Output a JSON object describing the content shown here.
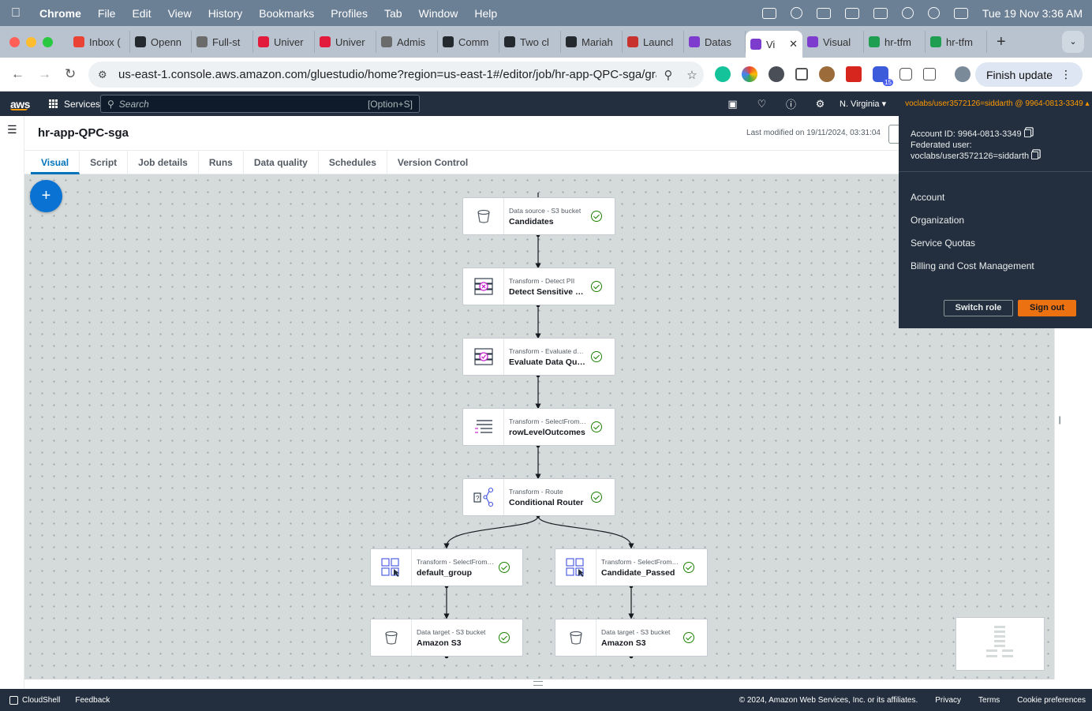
{
  "mac": {
    "app": "Chrome",
    "menu": [
      "File",
      "Edit",
      "View",
      "History",
      "Bookmarks",
      "Profiles",
      "Tab",
      "Window",
      "Help"
    ],
    "clock": "Tue 19 Nov  3:36 AM"
  },
  "tabs": [
    {
      "label": "Inbox (",
      "color": "#ea4335"
    },
    {
      "label": "Openn",
      "color": "#24292f"
    },
    {
      "label": "Full-st",
      "color": "#6b6b6b"
    },
    {
      "label": "Univer",
      "color": "#e21b3c"
    },
    {
      "label": "Univer",
      "color": "#e21b3c"
    },
    {
      "label": "Admis",
      "color": "#6b6b6b"
    },
    {
      "label": "Comm",
      "color": "#24292f"
    },
    {
      "label": "Two cl",
      "color": "#24292f"
    },
    {
      "label": "Mariah",
      "color": "#24292f"
    },
    {
      "label": "Launcl",
      "color": "#c7322f"
    },
    {
      "label": "Datas",
      "color": "#7e3ccf"
    },
    {
      "label": "Vi",
      "color": "#7e3ccf",
      "active": true
    },
    {
      "label": "Visual",
      "color": "#7e3ccf"
    },
    {
      "label": "hr-tfm",
      "color": "#1e9e50"
    },
    {
      "label": "hr-tfm",
      "color": "#1e9e50"
    }
  ],
  "browser": {
    "url": "us-east-1.console.aws.amazon.com/gluestudio/home?region=us-east-1#/editor/job/hr-app-QPC-sga/graph",
    "finish_update": "Finish update",
    "ext_badge": "15"
  },
  "awsnav": {
    "logo": "aws",
    "services": "Services",
    "search_placeholder": "Search",
    "search_shortcut": "[Option+S]",
    "region": "N. Virginia ▾",
    "account": "voclabs/user3572126=siddarth @ 9964-0813-3349 ▴"
  },
  "job": {
    "title": "hr-app-QPC-sga",
    "last_modified": "Last modified on 19/11/2024, 03:31:04",
    "tabs": [
      "Visual",
      "Script",
      "Job details",
      "Runs",
      "Data quality",
      "Schedules",
      "Version Control"
    ]
  },
  "nodes": [
    {
      "subtitle": "Data source - S3 bucket",
      "name": "Candidates",
      "icon": "bucket-icon"
    },
    {
      "subtitle": "Transform - Detect PII",
      "name": "Detect Sensitive Data",
      "icon": "detect-pii-icon"
    },
    {
      "subtitle": "Transform - Evaluate dat...",
      "name": "Evaluate Data Qualit...",
      "icon": "data-quality-icon"
    },
    {
      "subtitle": "Transform - SelectFromC...",
      "name": "rowLevelOutcomes",
      "icon": "list-icon"
    },
    {
      "subtitle": "Transform - Route",
      "name": "Conditional Router",
      "icon": "router-icon"
    },
    {
      "subtitle": "Transform - SelectFromC...",
      "name": "default_group",
      "icon": "select-icon"
    },
    {
      "subtitle": "Transform - SelectFromC...",
      "name": "Candidate_Passed",
      "icon": "select-icon"
    },
    {
      "subtitle": "Data target - S3 bucket",
      "name": "Amazon S3",
      "icon": "bucket-icon"
    },
    {
      "subtitle": "Data target - S3 bucket",
      "name": "Amazon S3",
      "icon": "bucket-icon"
    }
  ],
  "account_menu": {
    "account_id": "Account ID: 9964-0813-3349",
    "federated": "Federated user: voclabs/user3572126=siddarth",
    "links": [
      "Account",
      "Organization",
      "Service Quotas",
      "Billing and Cost Management"
    ],
    "switch_role": "Switch role",
    "sign_out": "Sign out"
  },
  "footer": {
    "cloudshell": "CloudShell",
    "feedback": "Feedback",
    "copyright": "© 2024, Amazon Web Services, Inc. or its affiliates.",
    "links": [
      "Privacy",
      "Terms",
      "Cookie preferences"
    ]
  }
}
